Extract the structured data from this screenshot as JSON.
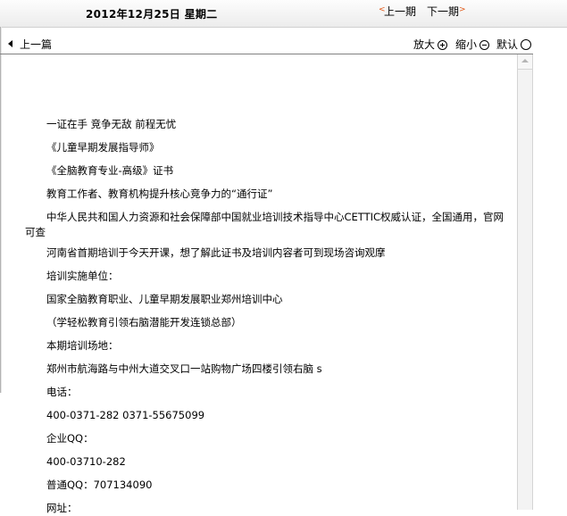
{
  "header": {
    "date": "2012年12月25日  星期二",
    "prev_issue": "上一期",
    "next_issue": "下一期"
  },
  "toolbar": {
    "prev_article": "上一篇",
    "zoom_in": "放大",
    "zoom_out": "缩小",
    "zoom_default": "默认"
  },
  "article": {
    "paragraphs": [
      "一证在手 竞争无敌 前程无忧",
      "《儿童早期发展指导师》",
      "《全脑教育专业-高级》证书",
      "教育工作者、教育机构提升核心竞争力的“通行证”",
      " 中华人民共和国人力资源和社会保障部中国就业培训技术指导中心CETTIC权威认证，全国通用，官网可查",
      "河南省首期培训于今天开课，想了解此证书及培训内容者可到现场咨询观摩",
      "培训实施单位：",
      "国家全脑教育职业、儿童早期发展职业郑州培训中心",
      "（学轻松教育引领右脑潜能开发连锁总部）",
      "本期培训场地：",
      "郑州市航海路与中州大道交叉口一站购物广场四楼引领右脑 s",
      "电话：",
      "400-0371-282  0371-55675099",
      "企业QQ：",
      "400-03710-282",
      "普通QQ：707134090",
      "网址："
    ]
  }
}
